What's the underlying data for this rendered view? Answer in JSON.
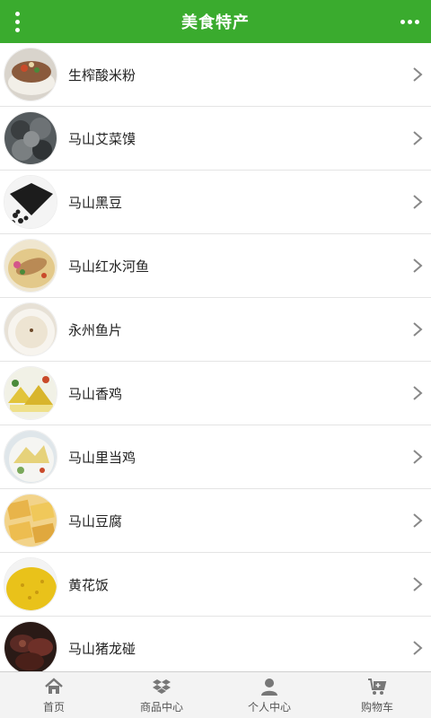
{
  "header": {
    "title": "美食特产",
    "menu_icon": "vertical-dots-icon",
    "more_icon": "horizontal-dots-icon"
  },
  "colors": {
    "header_bg": "#3aab2e",
    "tabbar_bg": "#f3f3f3",
    "icon_gray": "#777777"
  },
  "items": [
    {
      "label": "生榨酸米粉",
      "icon": "rice-noodle-thumb"
    },
    {
      "label": "马山艾菜馍",
      "icon": "dumpling-thumb"
    },
    {
      "label": "马山黑豆",
      "icon": "black-bean-thumb"
    },
    {
      "label": "马山红水河鱼",
      "icon": "fish-thumb"
    },
    {
      "label": "永州鱼片",
      "icon": "fish-slice-thumb"
    },
    {
      "label": "马山香鸡",
      "icon": "chicken-thumb"
    },
    {
      "label": "马山里当鸡",
      "icon": "chicken-dish-thumb"
    },
    {
      "label": "马山豆腐",
      "icon": "tofu-thumb"
    },
    {
      "label": "黄花饭",
      "icon": "yellow-rice-thumb"
    },
    {
      "label": "马山猪龙碰",
      "icon": "sausage-thumb"
    }
  ],
  "tabbar": [
    {
      "label": "首页",
      "icon": "home-icon"
    },
    {
      "label": "商品中心",
      "icon": "dropbox-icon"
    },
    {
      "label": "个人中心",
      "icon": "user-icon"
    },
    {
      "label": "购物车",
      "icon": "cart-icon"
    }
  ]
}
